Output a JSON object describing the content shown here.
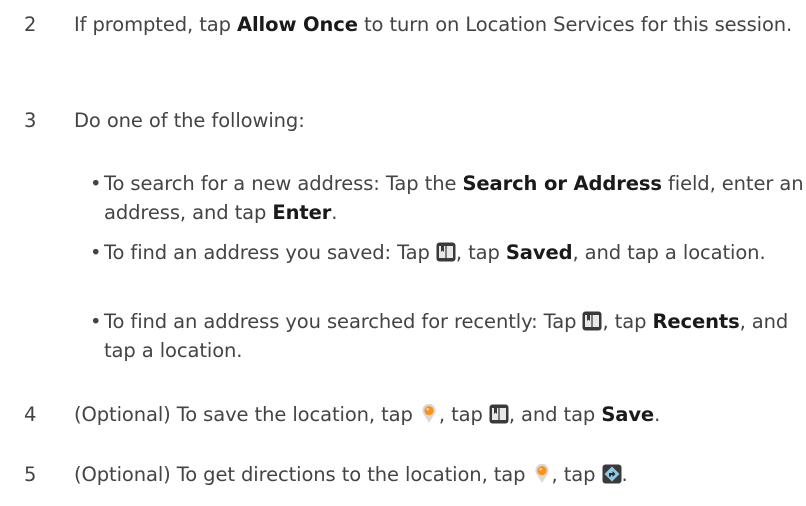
{
  "steps": [
    {
      "number": "2",
      "t1": "If prompted, tap ",
      "b1": "Allow Once",
      "t2": " to turn on Location Services for this session."
    },
    {
      "number": "3",
      "t1": "Do one of the following:"
    },
    {
      "number": "4",
      "t1": "(Optional) To save the location, tap ",
      "t2": ", tap ",
      "t3": ", and tap ",
      "b1": "Save",
      "t4": "."
    },
    {
      "number": "5",
      "t1": "(Optional) To get directions to the location, tap ",
      "t2": ", tap ",
      "t3": "."
    }
  ],
  "bullets": [
    {
      "dot": "•",
      "t1": "To search for a new address: Tap the ",
      "b1": "Search or Address",
      "t2": " field, enter an address, and tap ",
      "b2": "Enter",
      "t3": "."
    },
    {
      "dot": "•",
      "t1": "To find an address you saved: Tap ",
      "t2": ", tap ",
      "b1": "Saved",
      "t3": ", and tap a location."
    },
    {
      "dot": "•",
      "t1": "To find an address you searched for recently: Tap ",
      "t2": ", tap ",
      "b1": "Recents",
      "t3": ", and tap a location."
    }
  ],
  "icons": {
    "bookmark": "bookmarks-icon",
    "pin": "location-pin-icon",
    "directions": "directions-icon"
  },
  "colors": {
    "text": "#444444",
    "bold": "#1a1a1a",
    "pin": "#f7941d",
    "icon_dark": "#3a3a3a"
  }
}
